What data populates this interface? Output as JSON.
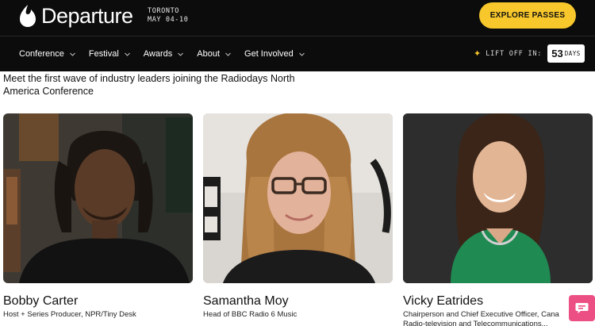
{
  "header": {
    "brand": "Departure",
    "city": "TORONTO",
    "dates": "MAY 04-10",
    "cta_label": "EXPLORE PASSES"
  },
  "nav": {
    "items": [
      {
        "label": "Conference"
      },
      {
        "label": "Festival"
      },
      {
        "label": "Awards"
      },
      {
        "label": "About"
      },
      {
        "label": "Get Involved"
      }
    ]
  },
  "countdown": {
    "label": "LIFT OFF IN:",
    "value": "53",
    "unit": "DAYS"
  },
  "intro": "Meet the first wave of industry leaders joining the Radiodays North America Conference",
  "speakers": [
    {
      "name": "Bobby Carter",
      "role": "Host + Series Producer, NPR/Tiny Desk"
    },
    {
      "name": "Samantha Moy",
      "role": "Head of BBC Radio 6 Music"
    },
    {
      "name": "Vicky Eatrides",
      "role": "Chairperson and Chief Executive Officer, Cana",
      "role_line2": "Radio-television and Telecommunications..."
    }
  ],
  "colors": {
    "header_bg": "#0c0c0c",
    "accent_yellow": "#f7c72b",
    "chat_pink": "#ec4f83"
  },
  "icons": {
    "brand": "flame-logo-icon",
    "nav_dropdown": "chevron-down-icon",
    "countdown": "sparkle-icon",
    "chat": "chat-bubble-icon"
  }
}
